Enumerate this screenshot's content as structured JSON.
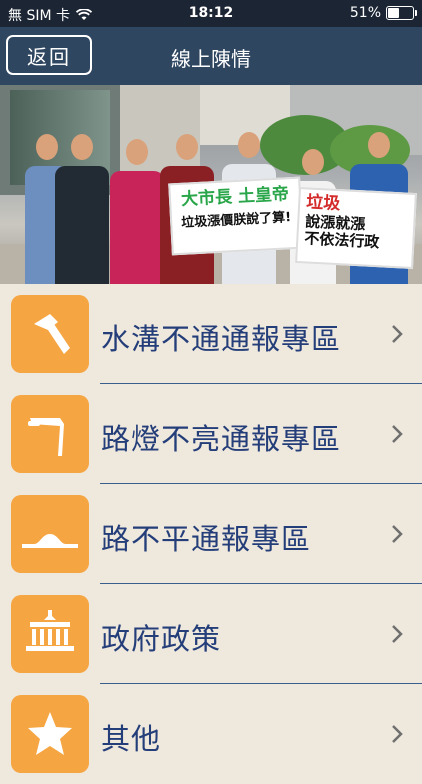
{
  "status_bar": {
    "carrier": "無 SIM 卡",
    "time": "18:12",
    "battery": "51%",
    "battery_level": 0.51
  },
  "navbar": {
    "back_label": "返回",
    "title": "線上陳情"
  },
  "banner": {
    "sign_left_line1": "大市長 土皇帝",
    "sign_left_line2": "垃圾漲價朕說了算!",
    "sign_right_line1": "垃圾",
    "sign_right_line2": "說漲就漲",
    "sign_right_line3": "不依法行政"
  },
  "menu": {
    "items": [
      {
        "label": "水溝不通通報專區",
        "icon": "hammer-icon"
      },
      {
        "label": "路燈不亮通報專區",
        "icon": "streetlight-icon"
      },
      {
        "label": "路不平通報專區",
        "icon": "road-bump-icon"
      },
      {
        "label": "政府政策",
        "icon": "government-building-icon"
      },
      {
        "label": "其他",
        "icon": "star-icon"
      }
    ]
  },
  "colors": {
    "status_bar": "#1b2533",
    "navbar": "#2f4660",
    "icon_bg": "#f5a541",
    "label": "#243e7a",
    "background": "#efe8dc"
  }
}
